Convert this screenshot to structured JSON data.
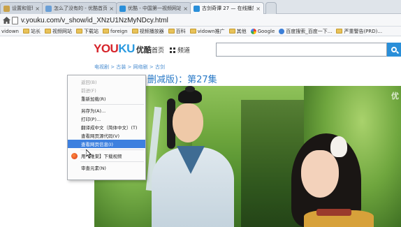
{
  "browser": {
    "tabs": [
      {
        "title": "设置和管理 - ..",
        "active": false,
        "favicon_color": "#c9a24a"
      },
      {
        "title": "怎么了没有的 - 优酷首页 ..",
        "active": false,
        "favicon_color": "#6a9fd6"
      },
      {
        "title": "优酷 - 中国第一视频网站 ..",
        "active": false,
        "favicon_color": "#2a8fd9"
      },
      {
        "title": "古剑奇谭 27 — 在线播放 ..",
        "active": true,
        "favicon_color": "#2a8fd9"
      }
    ],
    "close_symbol": "×",
    "url": "v.youku.com/v_show/id_XNzU1NzMyNDcy.html",
    "bookmarks": [
      {
        "label": "vidown",
        "icon": "page"
      },
      {
        "label": "站长",
        "icon": "folder"
      },
      {
        "label": "视频网站",
        "icon": "folder"
      },
      {
        "label": "下载站",
        "icon": "folder"
      },
      {
        "label": "foreign",
        "icon": "folder"
      },
      {
        "label": "视频播放器",
        "icon": "folder"
      },
      {
        "label": "百科",
        "icon": "folder"
      },
      {
        "label": "vidown推广",
        "icon": "folder"
      },
      {
        "label": "其他",
        "icon": "folder"
      },
      {
        "label": "Google",
        "icon": "google"
      },
      {
        "label": "百度搜索_百度一下...",
        "icon": "globe"
      },
      {
        "label": "严重警告(PRD)...",
        "icon": "folder"
      }
    ]
  },
  "site": {
    "logo_you": "YOU",
    "logo_ku": "KU",
    "logo_cn": "优酷",
    "nav_home": "首页",
    "nav_channel": "频道",
    "search_placeholder": "",
    "breadcrumb": "电视剧 > 古装 > 网络剧 > 古剑",
    "title_prefix": "古剑奇谭",
    "title_link": "古剑奇谭 (删减版)：第27集",
    "title_visible_suffix": "删减版)：第27集",
    "watermark": "优"
  },
  "context_menu": {
    "items": [
      {
        "label": "返回(B)",
        "disabled": true
      },
      {
        "label": "前进(F)",
        "disabled": true
      },
      {
        "label": "重新加载(R)",
        "disabled": false
      },
      {
        "sep": true
      },
      {
        "label": "另存为(A)...",
        "disabled": false
      },
      {
        "label": "打印(P)...",
        "disabled": false
      },
      {
        "label": "翻译成中文（简体中文）(T)",
        "disabled": false
      },
      {
        "label": "查看网页源代码(V)",
        "disabled": false
      },
      {
        "label": "查看网页信息(I)",
        "disabled": false,
        "highlighted": true
      },
      {
        "sep": true
      },
      {
        "label": "用【维棠】下载视频",
        "disabled": false,
        "icon": true
      },
      {
        "sep": true
      },
      {
        "label": "审查元素(N)",
        "disabled": false
      }
    ]
  },
  "colors": {
    "youku_red": "#d6232a",
    "youku_blue": "#2a9ae0",
    "menu_highlight": "#3d80df"
  }
}
